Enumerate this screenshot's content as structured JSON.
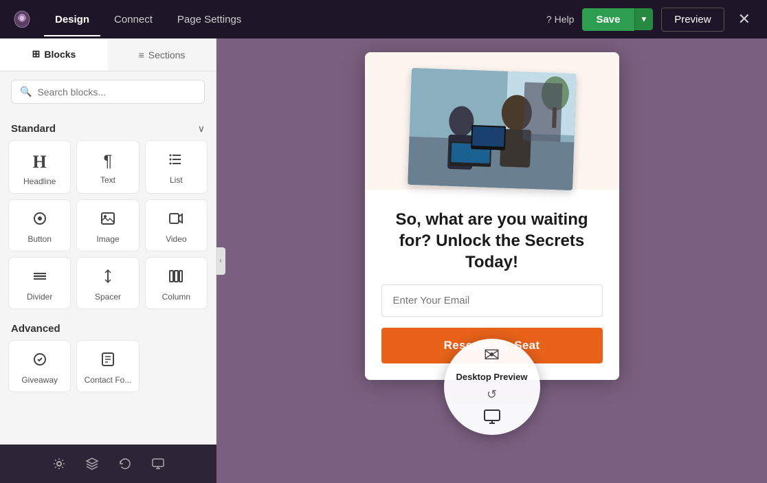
{
  "topnav": {
    "tabs": [
      {
        "id": "design",
        "label": "Design",
        "active": true
      },
      {
        "id": "connect",
        "label": "Connect",
        "active": false
      },
      {
        "id": "page_settings",
        "label": "Page Settings",
        "active": false
      }
    ],
    "help_label": "Help",
    "save_label": "Save",
    "preview_label": "Preview",
    "close_icon": "✕"
  },
  "left_panel": {
    "tabs": [
      {
        "id": "blocks",
        "label": "Blocks",
        "active": true,
        "icon": "⊞"
      },
      {
        "id": "sections",
        "label": "Sections",
        "active": false,
        "icon": "≡"
      }
    ],
    "search_placeholder": "Search blocks...",
    "standard_section": {
      "title": "Standard",
      "blocks": [
        {
          "id": "headline",
          "label": "Headline",
          "icon": "H"
        },
        {
          "id": "text",
          "label": "Text",
          "icon": "¶"
        },
        {
          "id": "list",
          "label": "List",
          "icon": "≡"
        },
        {
          "id": "button",
          "label": "Button",
          "icon": "⊙"
        },
        {
          "id": "image",
          "label": "Image",
          "icon": "⬜"
        },
        {
          "id": "video",
          "label": "Video",
          "icon": "▶"
        },
        {
          "id": "divider",
          "label": "Divider",
          "icon": "—"
        },
        {
          "id": "spacer",
          "label": "Spacer",
          "icon": "↕"
        },
        {
          "id": "column",
          "label": "Column",
          "icon": "⊟"
        }
      ]
    },
    "advanced_section": {
      "title": "Advanced",
      "blocks": [
        {
          "id": "giveaway",
          "label": "Giveaway",
          "icon": "★"
        },
        {
          "id": "contact_form",
          "label": "Contact Fo...",
          "icon": "📋"
        }
      ]
    }
  },
  "bottom_toolbar": {
    "icons": [
      "⚙",
      "◎",
      "↺",
      "👤"
    ]
  },
  "canvas": {
    "page_card": {
      "headline": "So, what are you waiting for? Unlock the Secrets Today!",
      "email_placeholder": "Enter Your Email",
      "cta_label": "Reserve My Seat"
    }
  },
  "desktop_preview_tooltip": {
    "icon": "✉",
    "label": "Desktop Preview",
    "refresh_icon": "↺",
    "monitor_icon": "🖥"
  }
}
